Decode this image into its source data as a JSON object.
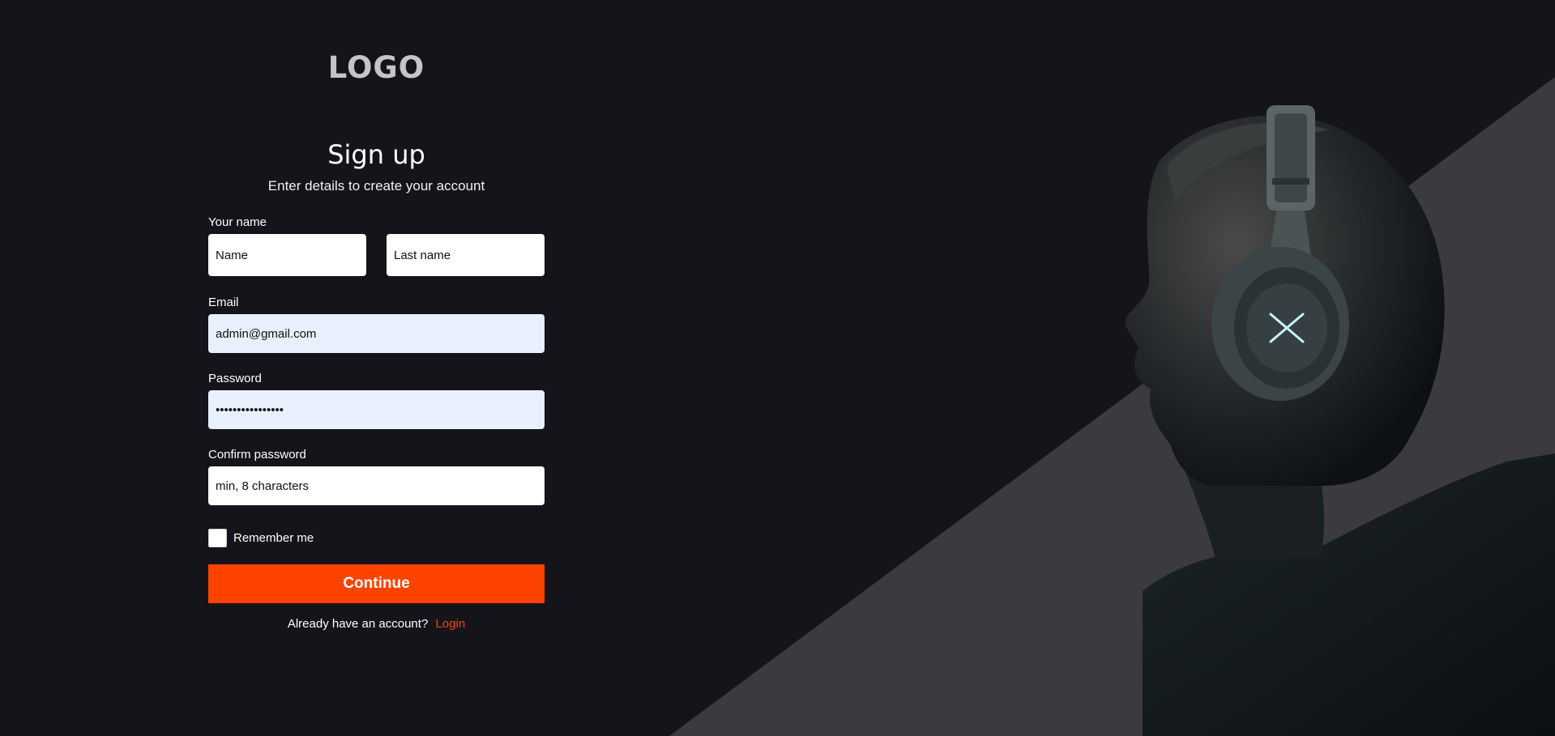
{
  "brand": {
    "logo_text": "LOGO"
  },
  "form": {
    "title": "Sign up",
    "subtitle": "Enter details to create your account",
    "name_label": "Your name",
    "first_name_placeholder": "Name",
    "last_name_placeholder": "Last name",
    "email_label": "Email",
    "email_value": "admin@gmail.com",
    "password_label": "Password",
    "password_value": "••••••••••••••••",
    "confirm_label": "Confirm password",
    "confirm_placeholder": "min, 8 characters",
    "remember_label": "Remember me",
    "remember_checked": false,
    "continue_label": "Continue",
    "footer_text": "Already have an account?",
    "login_label": "Login"
  },
  "theme": {
    "background": "#15141a",
    "accent": "#fe4200",
    "diagonal_band": "#3b3a3f",
    "autofill_bg": "#e8f0fe"
  },
  "hero": {
    "image_description_icon": "person-with-headphones-image"
  }
}
